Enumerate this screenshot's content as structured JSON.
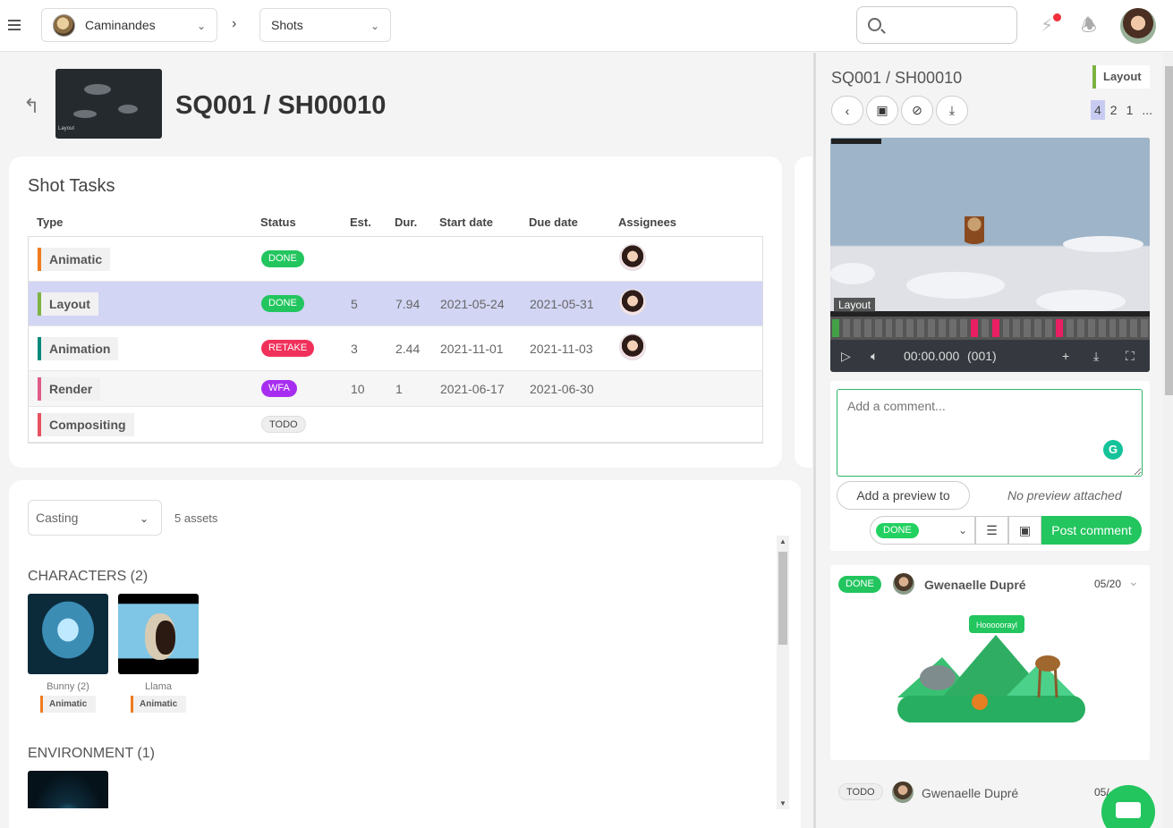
{
  "header": {
    "production": "Caminandes",
    "section": "Shots"
  },
  "entity": {
    "title": "SQ001 / SH00010",
    "thumb_label": "Layout"
  },
  "tasks": {
    "title": "Shot Tasks",
    "columns": [
      "Type",
      "Status",
      "Est.",
      "Dur.",
      "Start date",
      "Due date",
      "Assignees"
    ],
    "rows": [
      {
        "type": "Animatic",
        "color": "#ef7b1f",
        "status": "DONE",
        "status_color": "#22c55e",
        "est": "",
        "dur": "",
        "start": "",
        "due": "",
        "assignee": true
      },
      {
        "type": "Layout",
        "color": "#7cb342",
        "status": "DONE",
        "status_color": "#22c55e",
        "est": "5",
        "dur": "7.94",
        "start": "2021-05-24",
        "due": "2021-05-31",
        "assignee": true
      },
      {
        "type": "Animation",
        "color": "#00897b",
        "status": "RETAKE",
        "status_color": "#f0305a",
        "est": "3",
        "dur": "2.44",
        "start": "2021-11-01",
        "due": "2021-11-03",
        "assignee": true
      },
      {
        "type": "Render",
        "color": "#e05c8a",
        "status": "WFA",
        "status_color": "#a72ef0",
        "est": "10",
        "dur": "1",
        "start": "2021-06-17",
        "due": "2021-06-30",
        "assignee": false
      },
      {
        "type": "Compositing",
        "color": "#e8515f",
        "status": "TODO",
        "status_color": "#eeeeee",
        "est": "",
        "dur": "",
        "start": "",
        "due": "",
        "assignee": false
      }
    ]
  },
  "casting": {
    "mode": "Casting",
    "count": "5 assets",
    "characters_title": "CHARACTERS (2)",
    "environment_title": "ENVIRONMENT (1)",
    "characters": [
      {
        "name": "Bunny (2)",
        "task": "Animatic"
      },
      {
        "name": "Llama",
        "task": "Animatic"
      }
    ]
  },
  "panel": {
    "title": "SQ001 / SH00010",
    "task_type": "Layout",
    "revisions": [
      "4",
      "2",
      "1",
      "..."
    ],
    "preview_label": "Layout",
    "timecode": "00:00.000",
    "frame": "(001)",
    "comment_placeholder": "Add a comment...",
    "add_preview": "Add a preview to publish",
    "no_preview": "No preview attached",
    "status_value": "DONE",
    "post_label": "Post comment"
  },
  "comments": [
    {
      "status": "DONE",
      "author": "Gwenaelle Dupré",
      "date": "05/20",
      "bubble": "Hooooorayl"
    },
    {
      "status": "TODO",
      "author": "Gwenaelle Dupré",
      "date": "05/"
    }
  ]
}
